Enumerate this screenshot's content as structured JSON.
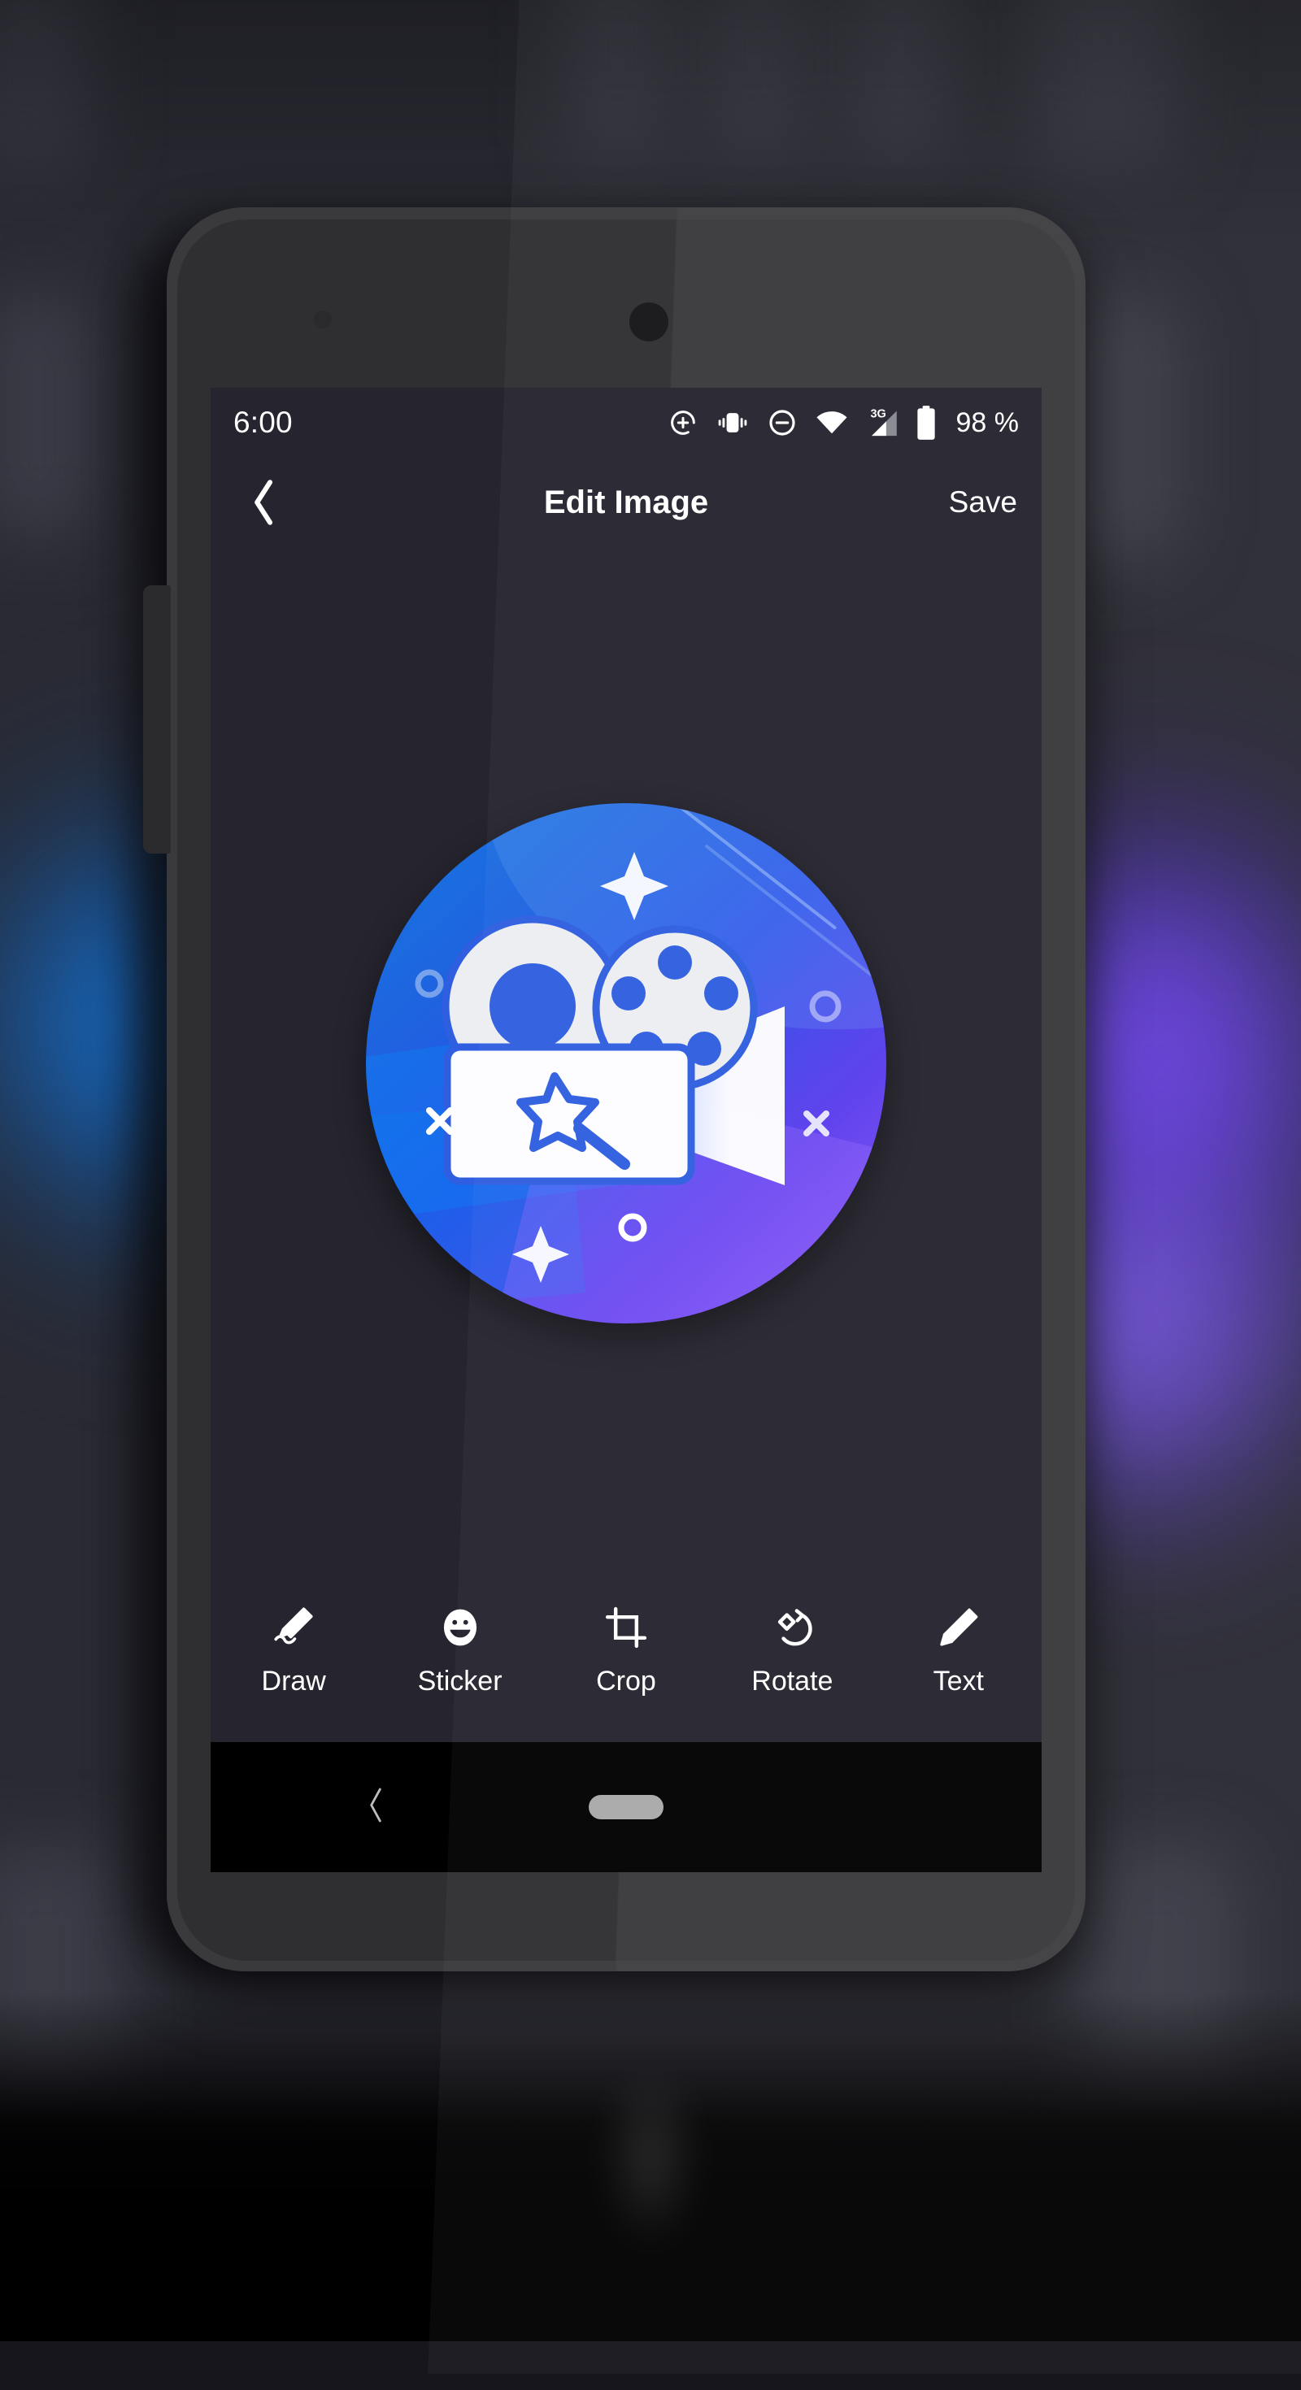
{
  "background": {
    "description": "blurred dark app screen behind the device mockup",
    "glow_left_color": "#1b82e8",
    "glow_right_color": "#8b5cf6"
  },
  "device": {
    "name": "android-phone-mockup",
    "frame_color": "#3a3a3c",
    "screen_bg": "#26252f"
  },
  "status_bar": {
    "time": "6:00",
    "battery_percent": "98 %",
    "icons": [
      "location-add-icon",
      "vibrate-icon",
      "do-not-disturb-icon",
      "wifi-icon",
      "cellular-3g-icon",
      "battery-icon"
    ],
    "network_label": "3G"
  },
  "app_bar": {
    "back_label": "‹",
    "title": "Edit Image",
    "save_label": "Save"
  },
  "canvas": {
    "image_name": "video-editor-app-logo",
    "logo": {
      "alt": "round movie projector app icon on blue to purple gradient",
      "gradient_start": "#1478e0",
      "gradient_mid": "#2a4fe8",
      "gradient_end": "#8b56f5",
      "body_color": "#f2f2f4",
      "accent_color": "#2f5fe0"
    }
  },
  "toolbar": {
    "items": [
      {
        "label": "Draw",
        "icon": "marker-pen-icon"
      },
      {
        "label": "Sticker",
        "icon": "smiley-face-icon"
      },
      {
        "label": "Crop",
        "icon": "crop-icon"
      },
      {
        "label": "Rotate",
        "icon": "rotate-icon"
      },
      {
        "label": "Text",
        "icon": "pencil-icon"
      }
    ]
  },
  "nav_bar": {
    "back_label": "‹",
    "home_pill": "gesture-pill",
    "bg_color": "#000000"
  }
}
